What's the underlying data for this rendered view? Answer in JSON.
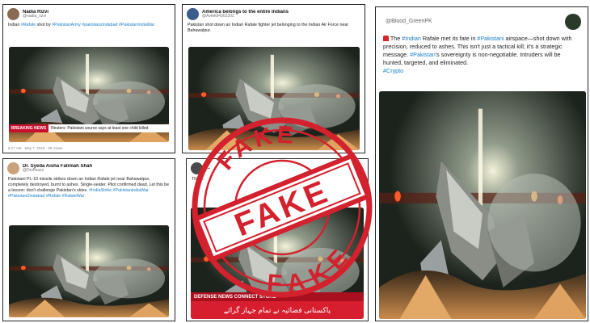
{
  "posts": [
    {
      "name": "Nadia Rizvi",
      "handle": "@nadia_rizvi",
      "body_prefix": "Indian ",
      "body_tag1": "#Rafale",
      "body_mid": " shot by ",
      "body_tags": "#PakistanArmy #pakistanzindabad #PakistanIndiaWar",
      "breaking_label": "BREAKING NEWS",
      "breaking_text": "Reuters: Pakistani source says at least one child killed",
      "time": "6:17 AM · May 7, 2025 · 39 Views"
    },
    {
      "name": "America belongs to the entire Indians",
      "handle": "@Avtek84362302",
      "body": "Pakistan shot down an Indian Rafale fighter jet belonging to the Indian Air Force near Bahawalpur."
    },
    {
      "name": "Dr. Syeda Aisha Fatimah Shah",
      "handle": "@Drsheazz",
      "body": "Pakistani PL-10 missile strikes down an Indian Rafale jet near Bahawalpur, completely destroyed, burnt to ashes. Single-seater. Pilot confirmed dead. Let this be a lesson: don't challenge Pakistan's skies.",
      "tags": "#IndiaStrike #PakistanIndiaWar #PakistanZindabad #Rafale #RafaleWar"
    },
    {
      "name": "...",
      "handle": "",
      "body_fragment": "This ...",
      "body_fragment2": "...roof",
      "ticker": "DEFENSE NEWS CONNECT STORE",
      "urdu": "پاکستانی فضائیہ نے تمام جہاز گرائے"
    },
    {
      "name": "Blood_GreenPK",
      "handle": "@Blood_GreenPK",
      "body_1": "The ",
      "tag_1": "#Indian",
      "body_2": " Rafale met its fate in ",
      "tag_2": "#Pakistani",
      "body_3": " airspace—shot down with precision, reduced to ashes. This isn't just a tactical kill; it's a strategic message. ",
      "tag_3": "#Pakistan",
      "body_4": "'s sovereignty is non-negotiable. Intruders will be hunted, targeted, and eliminated.",
      "tag_4": "#Crypto"
    }
  ],
  "stamp": {
    "top": "FAKE",
    "center": "FAKE",
    "bottom": "FAKE",
    "color": "#d3212d"
  },
  "icons": [
    "x-logo-icon",
    "avatar",
    "siren-icon"
  ]
}
